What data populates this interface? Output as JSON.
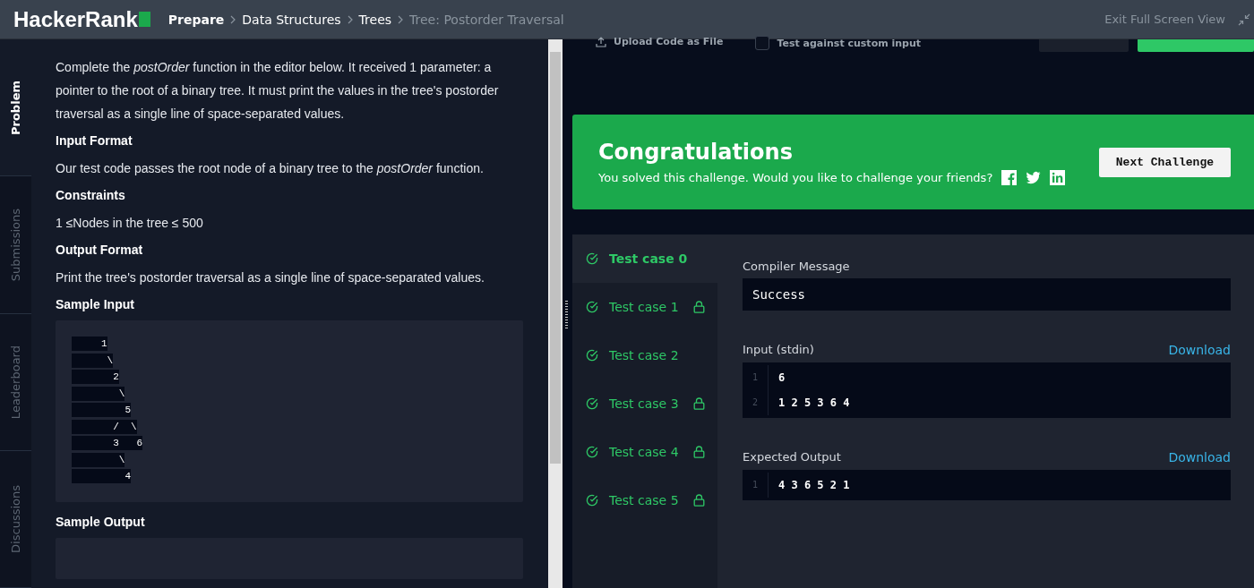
{
  "header": {
    "logo": "HackerRank",
    "breadcrumbs": [
      {
        "label": "Prepare",
        "current": false
      },
      {
        "label": "Data Structures",
        "current": false
      },
      {
        "label": "Trees",
        "current": false
      },
      {
        "label": "Tree: Postorder Traversal",
        "current": true
      }
    ],
    "exit_link": "Exit Full Screen View"
  },
  "side_tabs": [
    {
      "label": "Problem",
      "selected": true
    },
    {
      "label": "Submissions",
      "selected": false
    },
    {
      "label": "Leaderboard",
      "selected": false
    },
    {
      "label": "Discussions",
      "selected": false
    }
  ],
  "problem": {
    "sections": [
      {
        "kind": "paragraph",
        "text": "Complete the *postOrder* function in the editor below. It received 1 parameter: a pointer to the root of a binary tree. It must print the values in the tree's postorder traversal as a single line of space-separated values."
      },
      {
        "kind": "heading",
        "text": "Input Format"
      },
      {
        "kind": "paragraph",
        "text": "Our test code passes the root node of a binary tree to the *postOrder* function."
      },
      {
        "kind": "heading",
        "text": "Constraints"
      },
      {
        "kind": "paragraph",
        "text": "1 ≤Nodes in the tree ≤ 500"
      },
      {
        "kind": "heading",
        "text": "Output Format"
      },
      {
        "kind": "paragraph",
        "text": "Print the tree's postorder traversal as a single line of space-separated values."
      },
      {
        "kind": "heading",
        "text": "Sample Input"
      },
      {
        "kind": "code",
        "lines": [
          "     1",
          "      \\",
          "       2",
          "        \\",
          "         5",
          "       /  \\",
          "       3   6",
          "        \\",
          "         4"
        ]
      },
      {
        "kind": "heading",
        "text": "Sample Output"
      },
      {
        "kind": "code"
      }
    ]
  },
  "toolbar": {
    "upload": "Upload Code as File",
    "custom_input": {
      "label": "Test against custom input",
      "checked": false
    }
  },
  "banner": {
    "title": "Congratulations",
    "message": "You solved this challenge. Would you like to challenge your friends?",
    "button": "Next Challenge"
  },
  "test_cases": [
    {
      "label": "Test case 0",
      "selected": true,
      "locked": false
    },
    {
      "label": "Test case 1",
      "selected": false,
      "locked": true
    },
    {
      "label": "Test case 2",
      "selected": false,
      "locked": false
    },
    {
      "label": "Test case 3",
      "selected": false,
      "locked": true
    },
    {
      "label": "Test case 4",
      "selected": false,
      "locked": true
    },
    {
      "label": "Test case 5",
      "selected": false,
      "locked": true
    }
  ],
  "result": {
    "compiler_label": "Compiler Message",
    "compiler_message": "Success",
    "blocks": [
      {
        "label": "Input (stdin)",
        "download": "Download",
        "lines": [
          {
            "number": "1",
            "text": "6"
          },
          {
            "number": "2",
            "text": "1 2 5 3 6 4"
          }
        ]
      },
      {
        "label": "Expected Output",
        "download": "Download",
        "lines": [
          {
            "number": "1",
            "text": "4 3 6 5 2 1"
          }
        ]
      }
    ]
  }
}
